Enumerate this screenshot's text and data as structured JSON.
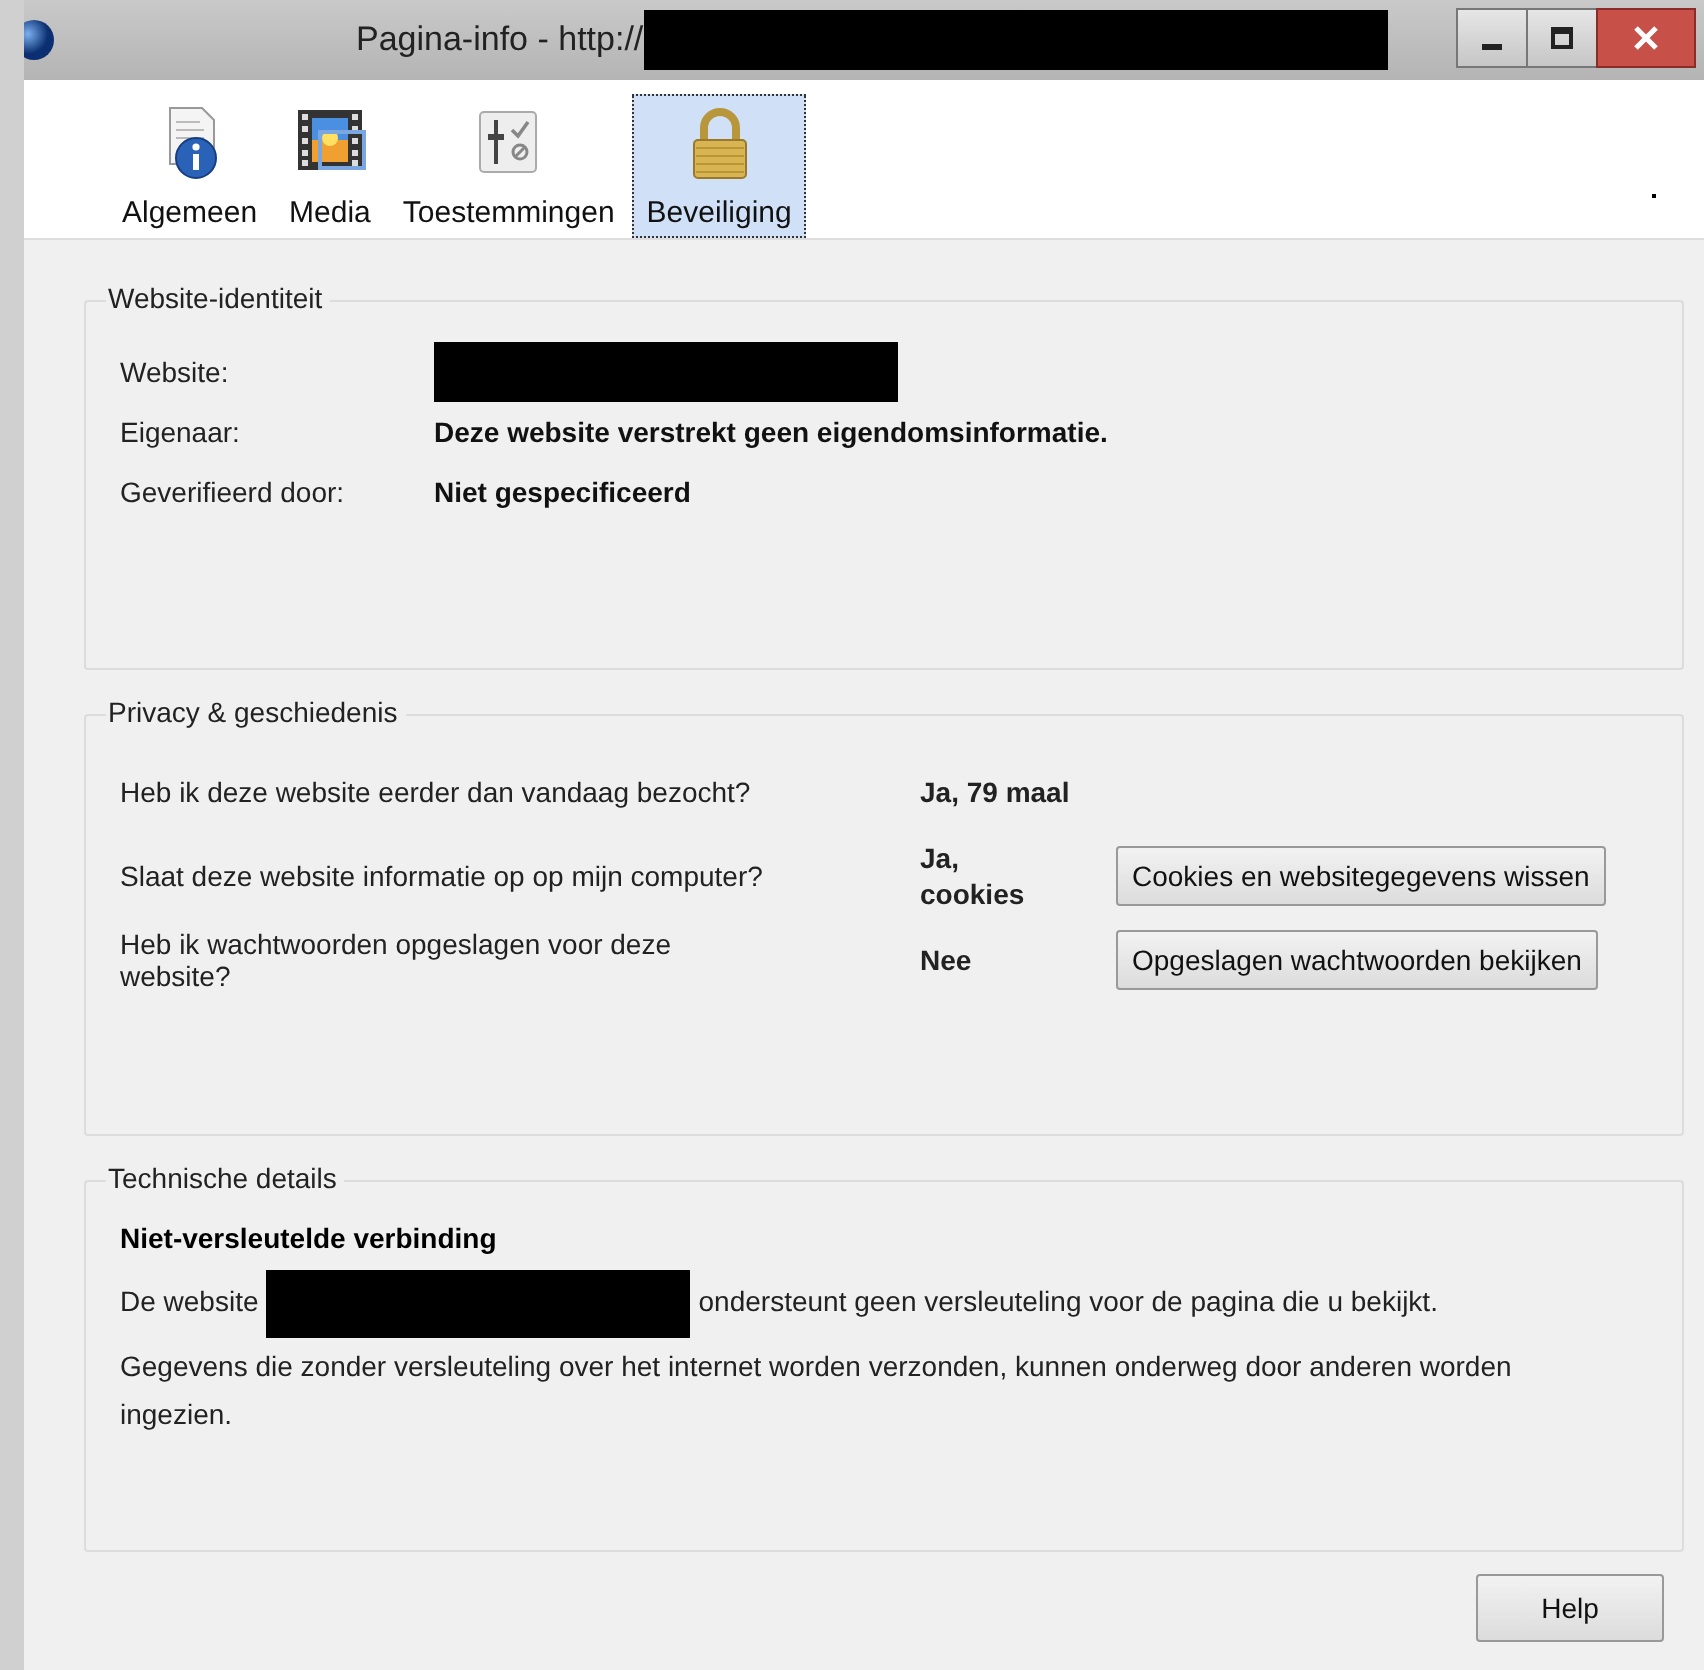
{
  "window": {
    "title": "Pagina-info - http://"
  },
  "tabs": [
    {
      "label": "Algemeen",
      "selected": false
    },
    {
      "label": "Media",
      "selected": false
    },
    {
      "label": "Toestemmingen",
      "selected": false
    },
    {
      "label": "Beveiliging",
      "selected": true
    }
  ],
  "identity": {
    "title": "Website-identiteit",
    "rows": [
      {
        "label": "Website:"
      },
      {
        "label": "Eigenaar:",
        "value": "Deze website verstrekt geen eigendomsinformatie."
      },
      {
        "label": "Geverifieerd door:",
        "value": "Niet gespecificeerd"
      }
    ]
  },
  "privacy": {
    "title": "Privacy & geschiedenis",
    "rows": [
      {
        "question": "Heb ik deze website eerder dan vandaag bezocht?",
        "answer": "Ja, 79 maal"
      },
      {
        "question": "Slaat deze website informatie op op mijn computer?",
        "answer": "Ja, cookies",
        "button": {
          "label": "Cookies en websitegegevens wissen"
        }
      },
      {
        "question": "Heb ik wachtwoorden opgeslagen voor deze website?",
        "answer": "Nee",
        "button": {
          "label": "Opgeslagen wachtwoorden bekijken"
        }
      }
    ]
  },
  "technical": {
    "title": "Technische details",
    "heading": "Niet-versleutelde verbinding",
    "paragraphs": [
      {
        "parts": [
          {
            "kind": "text",
            "text": "De website"
          },
          {
            "kind": "redacted"
          },
          {
            "kind": "text",
            "text": "ondersteunt geen versleuteling voor de pagina die u bekijkt."
          }
        ]
      },
      {
        "parts": [
          {
            "kind": "text",
            "text": "Gegevens die zonder versleuteling over het internet worden verzonden, kunnen onderweg door anderen worden ingezien."
          }
        ]
      }
    ]
  },
  "help_button": {
    "label": "Help"
  }
}
